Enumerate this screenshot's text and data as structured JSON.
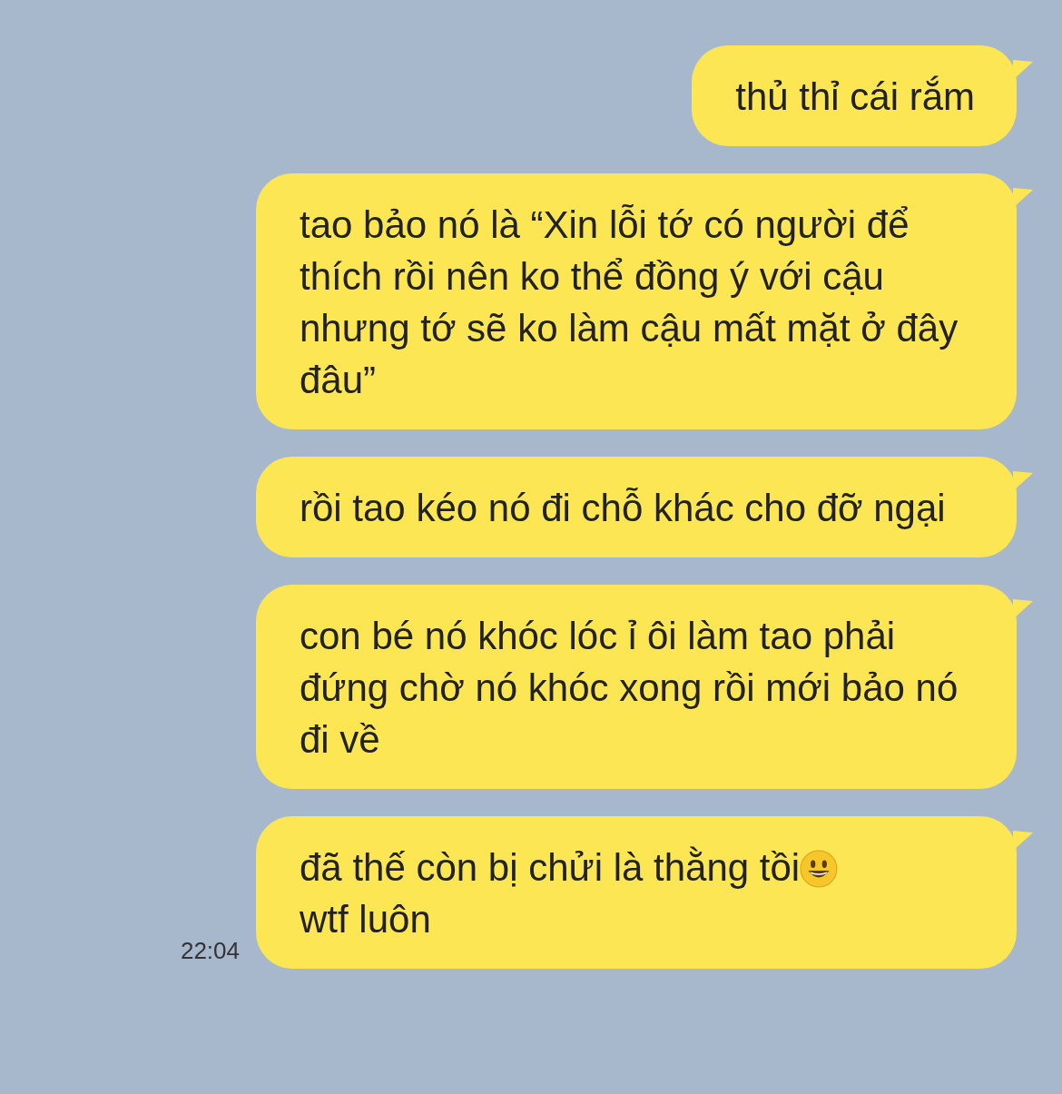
{
  "messages": [
    {
      "parts": [
        {
          "kind": "text",
          "text": "thủ thỉ cái rắm"
        }
      ]
    },
    {
      "parts": [
        {
          "kind": "text",
          "text": "tao bảo nó là “Xin lỗi tớ có người để thích rồi nên ko thể đồng ý với cậu nhưng tớ sẽ ko làm cậu mất mặt ở đây đâu”"
        }
      ]
    },
    {
      "parts": [
        {
          "kind": "text",
          "text": "rồi tao kéo nó đi chỗ khác cho đỡ ngại"
        }
      ]
    },
    {
      "parts": [
        {
          "kind": "text",
          "text": "con bé nó khóc lóc ỉ ôi làm tao phải đứng chờ nó khóc xong rồi mới bảo nó đi về"
        }
      ]
    },
    {
      "parts": [
        {
          "kind": "text",
          "text": "đã thế còn bị chửi là thằng tồi"
        },
        {
          "kind": "emoji"
        },
        {
          "kind": "text",
          "text": "wtf luôn"
        }
      ],
      "time": "22:04"
    }
  ]
}
